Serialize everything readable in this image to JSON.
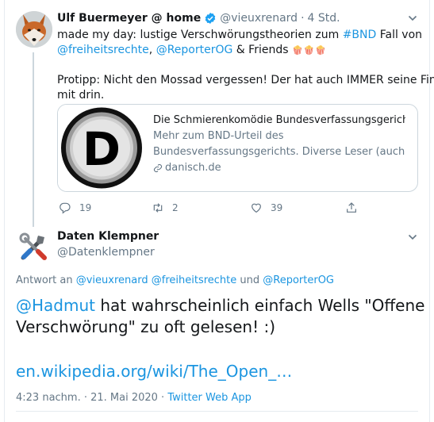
{
  "parent_tweet": {
    "author_name": "Ulf Buermeyer @ home",
    "handle": "@vieuxrenard",
    "separator": "·",
    "time": "4 Std.",
    "line1_prefix": "made my day: lustige Verschwörungstheorien zum ",
    "line1_hashtag": "#BND",
    "line1_suffix": " Fall von",
    "line2_mention1": "@freiheitsrechte",
    "line2_comma": ", ",
    "line2_mention2": "@ReporterOG",
    "line2_suffix": " & Friends ",
    "line2_emoji": "🍿🍿🍿",
    "line3": "Protipp: Nicht den Mossad vergessen! Der hat auch IMMER seine Finger",
    "line4": "mit drin.",
    "card": {
      "title": "Die Schmierenkomödie Bundesverfassungsgericht",
      "desc_line1": "Mehr zum BND-Urteil des",
      "desc_line2": "Bundesverfassungsgerichts. Diverse Leser (auch …",
      "domain": "danisch.de",
      "logo_letter": "D"
    },
    "actions": {
      "replies": "19",
      "retweets": "2",
      "likes": "39"
    }
  },
  "main_tweet": {
    "author_name": "Daten Klempner",
    "handle": "@Datenklempner",
    "reply_prefix": "Antwort an ",
    "reply_user1": "@vieuxrenard",
    "reply_user2": "@freiheitsrechte",
    "reply_und": " und ",
    "reply_user3": "@ReporterOG",
    "text_mention": "@Hadmut",
    "text_line1_rest": " hat wahrscheinlich einfach Wells \"Offene",
    "text_line2": "Verschwörung\" zu oft gelesen! :)",
    "link": "en.wikipedia.org/wiki/The_Open_…",
    "timestamp": "4:23 nachm. · 21. Mai 2020 · ",
    "source": "Twitter Web App"
  },
  "colors": {
    "link_blue": "#1b95e0",
    "verified_blue": "#1da1f2",
    "secondary_text": "#657786",
    "border": "#ccd6dd"
  },
  "icons": [
    "verified-badge-icon",
    "chevron-down-icon",
    "reply-icon",
    "retweet-icon",
    "like-icon",
    "share-icon",
    "link-icon",
    "tools-avatar-icon",
    "fox-avatar"
  ]
}
